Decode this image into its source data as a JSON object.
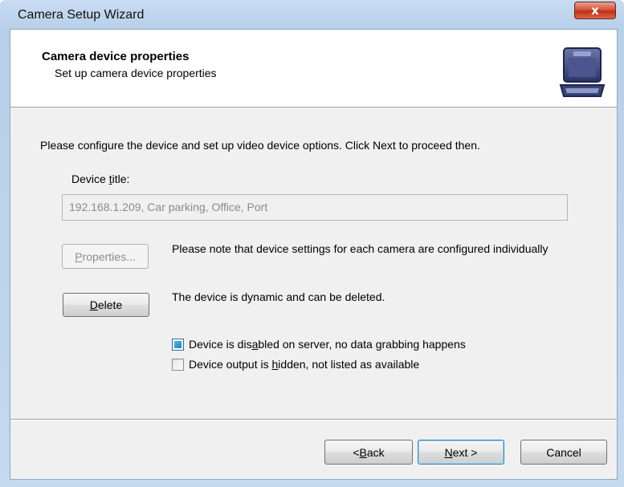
{
  "window": {
    "title": "Camera Setup Wizard",
    "close_label": "x"
  },
  "header": {
    "title": "Camera device properties",
    "subtitle": "Set up camera device properties",
    "icon": "camera-case-icon"
  },
  "body": {
    "instruction": "Please configure the device and set up video device options. Click Next to proceed then.",
    "device_title_label_pre": "Device ",
    "device_title_label_ul": "t",
    "device_title_label_post": "itle:",
    "device_title_value": "192.168.1.209, Car parking, Office, Port",
    "properties_button_ul": "P",
    "properties_button_rest": "roperties...",
    "properties_note": "Please note that device settings for each camera are configured individually",
    "delete_button_ul": "D",
    "delete_button_rest": "elete",
    "dynamic_note": "The device is dynamic and can be deleted.",
    "checkbox_disabled": {
      "pre": "Device is dis",
      "ul": "a",
      "post": "bled on server, no data grabbing happens",
      "checked": true
    },
    "checkbox_hidden": {
      "pre": "Device output is ",
      "ul": "h",
      "post": "idden, not listed as available",
      "checked": false
    }
  },
  "footer": {
    "back_pre": "< ",
    "back_ul": "B",
    "back_post": "ack",
    "next_ul": "N",
    "next_post": "ext >",
    "cancel": "Cancel"
  },
  "colors": {
    "close": "#c8381c",
    "accent": "#3c7fb1",
    "disabled_text": "#8b8b8b"
  }
}
